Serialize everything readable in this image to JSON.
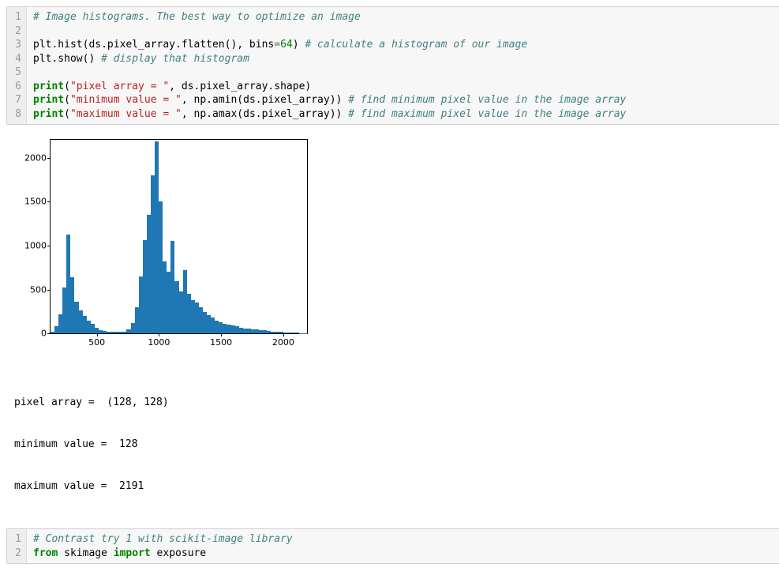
{
  "cell1": {
    "lines": [
      {
        "n": "1",
        "html": "<span class='c-comment'># Image histograms. The best way to optimize an image</span>"
      },
      {
        "n": "2",
        "html": ""
      },
      {
        "n": "3",
        "html": "plt.hist(ds.pixel_array.flatten(), bins<span class='c-op'>=</span><span class='c-num'>64</span>) <span class='c-comment'># calculate a histogram of our image</span>"
      },
      {
        "n": "4",
        "html": "plt.show() <span class='c-comment'># display that histogram</span>"
      },
      {
        "n": "5",
        "html": ""
      },
      {
        "n": "6",
        "html": "<span class='c-kw'>print</span>(<span class='c-str'>\"pixel array = \"</span>, ds.pixel_array.shape)"
      },
      {
        "n": "7",
        "html": "<span class='c-kw'>print</span>(<span class='c-str'>\"minimum value = \"</span>, np.amin(ds.pixel_array)) <span class='c-comment'># find minimum pixel value in the image array</span>"
      },
      {
        "n": "8",
        "html": "<span class='c-kw'>print</span>(<span class='c-str'>\"maximum value = \"</span>, np.amax(ds.pixel_array)) <span class='c-comment'># find maximum pixel value in the image array</span>"
      }
    ]
  },
  "chart_data": {
    "type": "bar",
    "title": "",
    "xlabel": "",
    "ylabel": "",
    "xlim": [
      128,
      2191
    ],
    "ylim": [
      0,
      2200
    ],
    "xticks": [
      500,
      1000,
      1500,
      2000
    ],
    "yticks": [
      0,
      500,
      1000,
      1500,
      2000
    ],
    "bin_edges_approx": "64 equal bins over [128,2191]",
    "values": [
      20,
      80,
      220,
      520,
      1130,
      640,
      360,
      260,
      200,
      150,
      110,
      70,
      40,
      30,
      25,
      20,
      20,
      20,
      25,
      50,
      120,
      300,
      650,
      1060,
      1350,
      1800,
      2190,
      1500,
      820,
      700,
      1050,
      600,
      480,
      720,
      450,
      380,
      350,
      300,
      250,
      210,
      180,
      150,
      130,
      110,
      100,
      90,
      80,
      70,
      60,
      55,
      50,
      45,
      40,
      35,
      30,
      25,
      22,
      20,
      15,
      12,
      10,
      8,
      5,
      3
    ]
  },
  "stdout": {
    "line1": "pixel array =  (128, 128)",
    "line2": "minimum value =  128",
    "line3": "maximum value =  2191"
  },
  "cell2": {
    "lines": [
      {
        "n": "1",
        "html": "<span class='c-comment'># Contrast try 1 with scikit-image library</span>"
      },
      {
        "n": "2",
        "html": "<span class='c-kw'>from</span> skimage <span class='c-kw'>import</span> exposure"
      }
    ]
  }
}
